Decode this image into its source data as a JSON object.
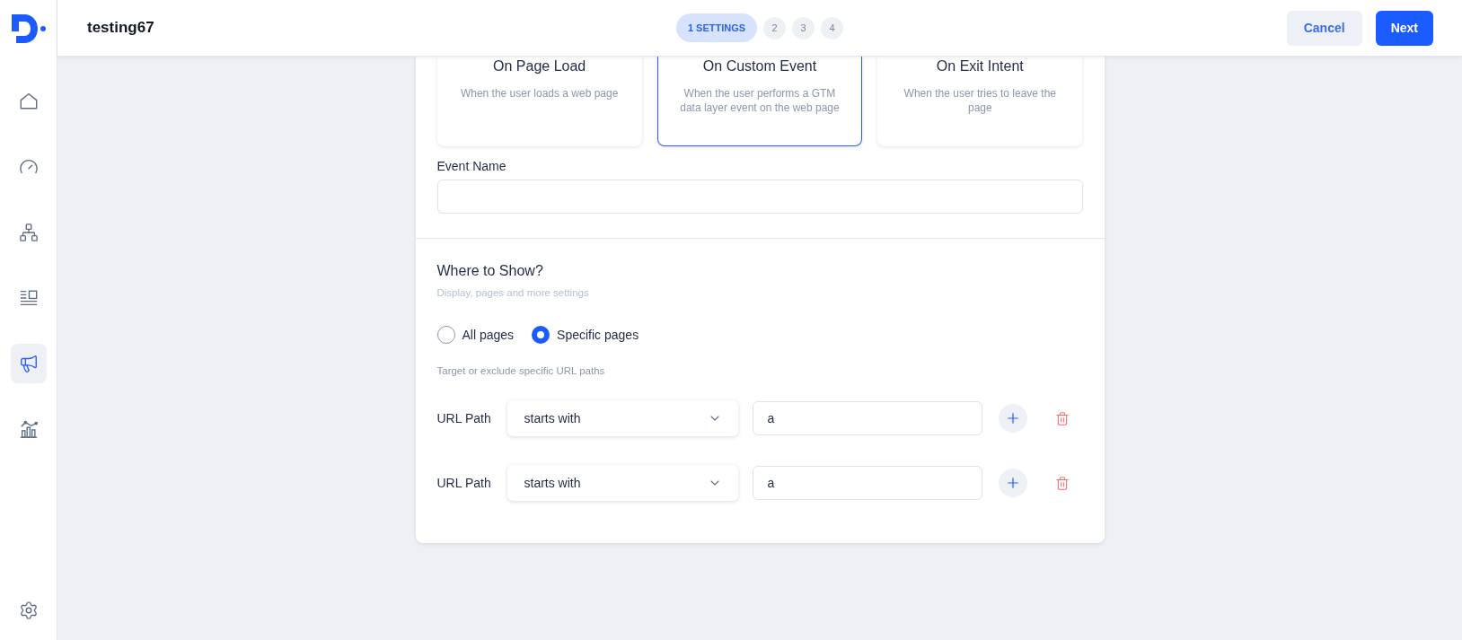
{
  "sidebar": {
    "items": [
      {
        "selected": false
      },
      {
        "selected": false
      },
      {
        "selected": false
      },
      {
        "selected": false
      },
      {
        "selected": true
      },
      {
        "selected": false
      }
    ],
    "settings": {
      "selected": false
    }
  },
  "header": {
    "title": "testing67",
    "steps": [
      {
        "label": "1 SETTINGS",
        "selected": true
      },
      {
        "label": "2",
        "selected": false
      },
      {
        "label": "3",
        "selected": false
      },
      {
        "label": "4",
        "selected": false
      }
    ],
    "buttons": [
      {
        "label": "Cancel",
        "kind": "secondary"
      },
      {
        "label": "Next",
        "kind": "primary"
      }
    ]
  },
  "triggers": [
    {
      "title": "On Page Load",
      "description": "When the user loads a web page",
      "selected": false
    },
    {
      "title": "On Custom Event",
      "description": "When the user performs a GTM data layer event on the web page",
      "selected": true
    },
    {
      "title": "On Exit Intent",
      "description": "When the user tries to leave the page",
      "selected": false
    }
  ],
  "event_name": {
    "label": "Event Name"
  },
  "where_to_show": {
    "title": "Where to Show?",
    "subtitle": "Display, pages and more settings",
    "options": [
      {
        "label": "All pages",
        "selected": false
      },
      {
        "label": "Specific pages",
        "selected": true
      }
    ],
    "hint": "Target or exclude specific URL paths",
    "rules": [
      {
        "label": "URL Path",
        "operator": "starts with",
        "value": "a"
      },
      {
        "label": "URL Path",
        "operator": "starts with",
        "value": "a"
      }
    ]
  }
}
